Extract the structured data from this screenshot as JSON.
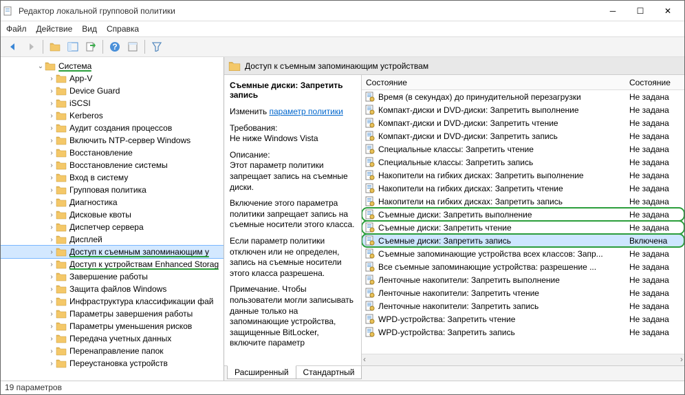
{
  "window": {
    "title": "Редактор локальной групповой политики"
  },
  "menu": [
    "Файл",
    "Действие",
    "Вид",
    "Справка"
  ],
  "header": {
    "path": "Доступ к съемным запоминающим устройствам"
  },
  "detail": {
    "title": "Съемные диски: Запретить запись",
    "edit_label": "Изменить",
    "edit_link": "параметр политики",
    "req_head": "Требования:",
    "req_body": "Не ниже Windows Vista",
    "desc_head": "Описание:",
    "desc_body": "Этот параметр политики запрещает запись на съемные диски.",
    "p2": "Включение этого параметра политики запрещает запись на съемные носители этого класса.",
    "p3": "Если параметр политики отключен или не определен, запись на съемные носители этого класса разрешена.",
    "p4": "Примечание. Чтобы пользователи могли записывать данные только на запоминающие устройства, защищенные BitLocker, включите параметр"
  },
  "columns": {
    "name": "Состояние",
    "state": "Состояние"
  },
  "tree": {
    "root": "Система",
    "children": [
      "App-V",
      "Device Guard",
      "iSCSI",
      "Kerberos",
      "Аудит создания процессов",
      "Включить NTP-сервер Windows",
      "Восстановление",
      "Восстановление системы",
      "Вход в систему",
      "Групповая политика",
      "Диагностика",
      "Дисковые квоты",
      "Диспетчер сервера",
      "Дисплей",
      "Доступ к съемным запоминающим у",
      "Доступ к устройствам Enhanced Storag",
      "Завершение работы",
      "Защита файлов Windows",
      "Инфраструктура классификации фай",
      "Параметры завершения работы",
      "Параметры уменьшения рисков",
      "Передача учетных данных",
      "Перенаправление папок",
      "Переустановка устройств"
    ]
  },
  "rows": [
    {
      "name": "Время (в секундах) до принудительной перезагрузки",
      "state": "Не задана"
    },
    {
      "name": "Компакт-диски и DVD-диски: Запретить выполнение",
      "state": "Не задана"
    },
    {
      "name": "Компакт-диски и DVD-диски: Запретить чтение",
      "state": "Не задана"
    },
    {
      "name": "Компакт-диски и DVD-диски: Запретить запись",
      "state": "Не задана"
    },
    {
      "name": "Специальные классы: Запретить чтение",
      "state": "Не задана"
    },
    {
      "name": "Специальные классы: Запретить запись",
      "state": "Не задана"
    },
    {
      "name": "Накопители на гибких дисках: Запретить выполнение",
      "state": "Не задана"
    },
    {
      "name": "Накопители на гибких дисках: Запретить чтение",
      "state": "Не задана"
    },
    {
      "name": "Накопители на гибких дисках: Запретить запись",
      "state": "Не задана"
    },
    {
      "name": "Съемные диски: Запретить выполнение",
      "state": "Не задана",
      "ring": true
    },
    {
      "name": "Съемные диски: Запретить чтение",
      "state": "Не задана",
      "ring": true
    },
    {
      "name": "Съемные диски: Запретить запись",
      "state": "Включена",
      "sel": true,
      "ring": true
    },
    {
      "name": "Съемные запоминающие устройства всех классов: Запр...",
      "state": "Не задана"
    },
    {
      "name": "Все съемные запоминающие устройства: разрешение ...",
      "state": "Не задана"
    },
    {
      "name": "Ленточные накопители: Запретить выполнение",
      "state": "Не задана"
    },
    {
      "name": "Ленточные накопители: Запретить чтение",
      "state": "Не задана"
    },
    {
      "name": "Ленточные накопители: Запретить запись",
      "state": "Не задана"
    },
    {
      "name": "WPD-устройства: Запретить чтение",
      "state": "Не задана"
    },
    {
      "name": "WPD-устройства: Запретить запись",
      "state": "Не задана"
    }
  ],
  "tabs": {
    "ext": "Расширенный",
    "std": "Стандартный"
  },
  "status": "19 параметров"
}
